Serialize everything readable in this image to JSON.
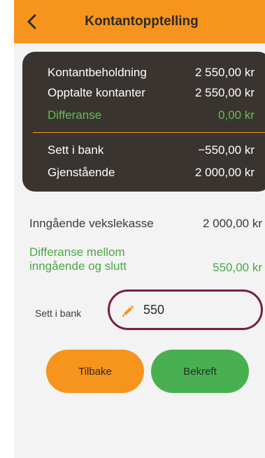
{
  "header": {
    "title": "Kontantopptelling",
    "back_icon": "chevron-left-icon"
  },
  "summary": {
    "rows": [
      {
        "label": "Kontantbeholdning",
        "value": "2 550,00 kr"
      },
      {
        "label": "Opptalte kontanter",
        "value": "2 550,00 kr"
      },
      {
        "label": "Differanse",
        "value": "0,00 kr"
      },
      {
        "label": "Sett i bank",
        "value": "−550,00 kr"
      },
      {
        "label": "Gjenstående",
        "value": "2 000,00 kr"
      }
    ]
  },
  "opening": {
    "label": "Inngående vekslekasse",
    "value": "2 000,00 kr"
  },
  "difference": {
    "label": "Differanse mellom inngående og slutt",
    "value": "550,00 kr"
  },
  "bank_input": {
    "label": "Sett i bank",
    "value": "550",
    "icon": "pencil-icon"
  },
  "buttons": {
    "back_label": "Tilbake",
    "confirm_label": "Bekreft"
  },
  "colors": {
    "accent_orange": "#f7941d",
    "dark_panel": "#3a3431",
    "green": "#5cc04f",
    "confirm_green": "#48b050",
    "input_border": "#7a1f3d"
  }
}
